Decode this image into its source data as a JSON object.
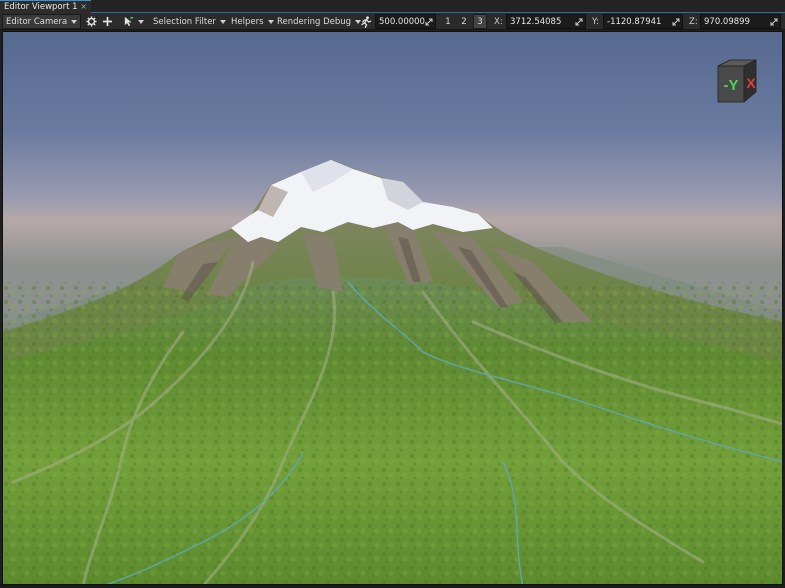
{
  "tab": {
    "title": "Editor Viewport 1",
    "close": "×"
  },
  "toolbar": {
    "camera": "Editor Camera",
    "settings_icon": "gear-icon",
    "add_icon": "plus-icon",
    "select_icon": "cursor-icon",
    "selection_filter": "Selection Filter",
    "helpers": "Helpers",
    "rendering_debug": "Rendering Debug",
    "speed_icon": "running-man-icon",
    "speed": "500.00000",
    "buttons": [
      "1",
      "2",
      "3"
    ],
    "x_label": "X:",
    "x_value": "3712.54085",
    "y_label": "Y:",
    "y_value": "-1120.87941",
    "z_label": "Z:",
    "z_value": "970.09899"
  },
  "gizmo": {
    "y_label": "-Y",
    "x_label": "X",
    "y_color": "#4fd44f",
    "x_color": "#e23b3b"
  },
  "colors": {
    "accent": "#3d8fd6",
    "sky_top": "#5a6d96",
    "sky_horizon": "#b6a8a8",
    "grass": "#6e9a38",
    "snow": "#f2f3f6"
  }
}
